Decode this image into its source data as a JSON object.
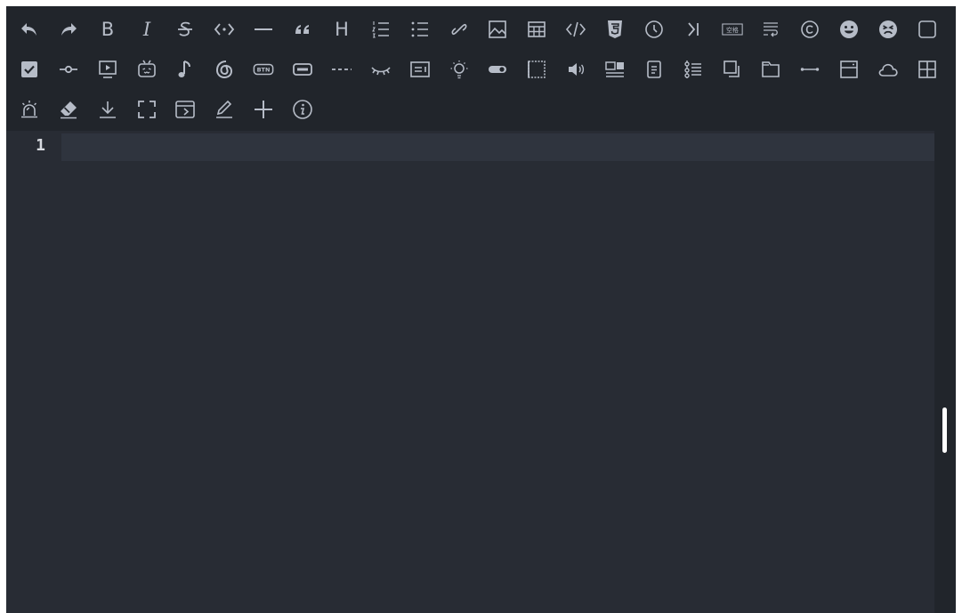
{
  "toolbar": {
    "bold_label": "B",
    "italic_label": "I",
    "heading_label": "H",
    "quote_label": "❝",
    "link_label": "🔗",
    "btn_label": "BTN",
    "space_label": "空格",
    "more_label": "- - -"
  },
  "editor": {
    "line_numbers": [
      "1"
    ]
  },
  "colors": {
    "editor_bg": "#282c34",
    "toolbar_bg": "#21252b",
    "icon": "#b6bcc7",
    "active_line": "#2f343e",
    "line_number": "#d7dae0",
    "scroll_thumb": "#ffffff"
  },
  "icons": [
    "undo-icon",
    "redo-icon",
    "bold-icon",
    "italic-icon",
    "strikethrough-icon",
    "inline-code-icon",
    "horizontal-rule-icon",
    "quote-icon",
    "heading-icon",
    "ordered-list-icon",
    "unordered-list-icon",
    "link-icon",
    "image-icon",
    "table-icon",
    "code-block-icon",
    "html-icon",
    "history-icon",
    "sub-icon",
    "space-icon",
    "word-wrap-icon",
    "copyright-icon",
    "smile-icon",
    "sad-icon",
    "checkbox-icon",
    "checked-icon",
    "timeline-icon",
    "video-icon",
    "bilibili-icon",
    "music-icon",
    "netease-icon",
    "btn-icon",
    "input-icon",
    "dashed-line-icon",
    "hidden-icon",
    "card-icon",
    "light-icon",
    "switch-icon",
    "frame-icon",
    "audio-icon",
    "layout-icon",
    "note-icon",
    "steps-icon",
    "copy-icon",
    "tab-icon",
    "divider-icon",
    "panel-icon",
    "cloud-icon",
    "grid-icon",
    "alarm-icon",
    "eraser-icon",
    "download-icon",
    "fullscreen-icon",
    "preview-icon",
    "edit-icon",
    "add-icon",
    "info-icon"
  ]
}
